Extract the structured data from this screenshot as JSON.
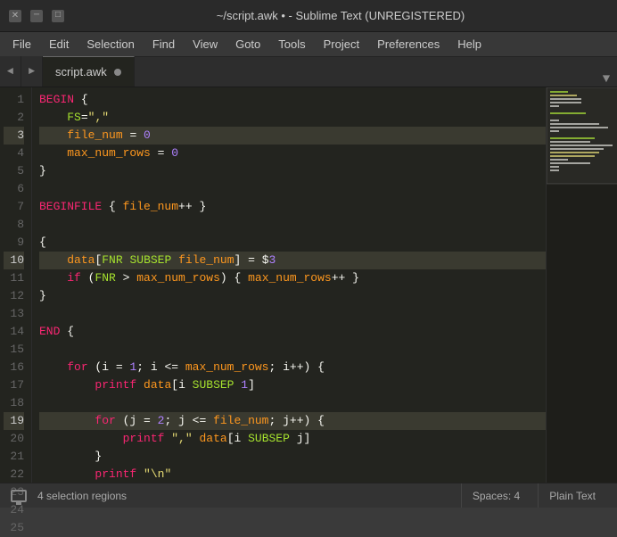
{
  "titlebar": {
    "close_btn": "✕",
    "min_btn": "─",
    "max_btn": "□",
    "title": "~/script.awk • - Sublime Text (UNREGISTERED)"
  },
  "menubar": {
    "items": [
      "File",
      "Edit",
      "Selection",
      "Find",
      "View",
      "Goto",
      "Tools",
      "Project",
      "Preferences",
      "Help"
    ]
  },
  "tabs": {
    "nav_left": "◄",
    "nav_right": "►",
    "items": [
      {
        "label": "script.awk",
        "active": true,
        "modified": true
      }
    ],
    "dropdown": "▼"
  },
  "editor": {
    "lines": [
      {
        "num": 1,
        "code": "BEGIN {",
        "selected": false
      },
      {
        "num": 2,
        "code": "    FS=\",\"",
        "selected": false
      },
      {
        "num": 3,
        "code": "    file_num = 0",
        "selected": true
      },
      {
        "num": 4,
        "code": "    max_num_rows = 0",
        "selected": false
      },
      {
        "num": 5,
        "code": "}",
        "selected": false
      },
      {
        "num": 6,
        "code": "",
        "selected": false
      },
      {
        "num": 7,
        "code": "BEGINFILE { file_num++ }",
        "selected": false
      },
      {
        "num": 8,
        "code": "",
        "selected": false
      },
      {
        "num": 9,
        "code": "{",
        "selected": false
      },
      {
        "num": 10,
        "code": "    data[FNR SUBSEP file_num] = $3",
        "selected": true
      },
      {
        "num": 11,
        "code": "    if (FNR > max_num_rows) { max_num_rows++ }",
        "selected": false
      },
      {
        "num": 12,
        "code": "}",
        "selected": false
      },
      {
        "num": 13,
        "code": "",
        "selected": false
      },
      {
        "num": 14,
        "code": "END {",
        "selected": false
      },
      {
        "num": 15,
        "code": "",
        "selected": false
      },
      {
        "num": 16,
        "code": "    for (i = 1; i <= max_num_rows; i++) {",
        "selected": false
      },
      {
        "num": 17,
        "code": "        printf data[i SUBSEP 1]",
        "selected": false
      },
      {
        "num": 18,
        "code": "",
        "selected": false
      },
      {
        "num": 19,
        "code": "        for (j = 2; j <= file_num; j++) {",
        "selected": true
      },
      {
        "num": 20,
        "code": "            printf \",\" data[i SUBSEP j]",
        "selected": false
      },
      {
        "num": 21,
        "code": "        }",
        "selected": false
      },
      {
        "num": 22,
        "code": "        printf \"\\n\"",
        "selected": false
      },
      {
        "num": 23,
        "code": "    }",
        "selected": false
      },
      {
        "num": 24,
        "code": "}",
        "selected": false
      },
      {
        "num": 25,
        "code": "",
        "selected": false
      }
    ]
  },
  "statusbar": {
    "selection_info": "4 selection regions",
    "spaces": "Spaces: 4",
    "syntax": "Plain Text"
  }
}
